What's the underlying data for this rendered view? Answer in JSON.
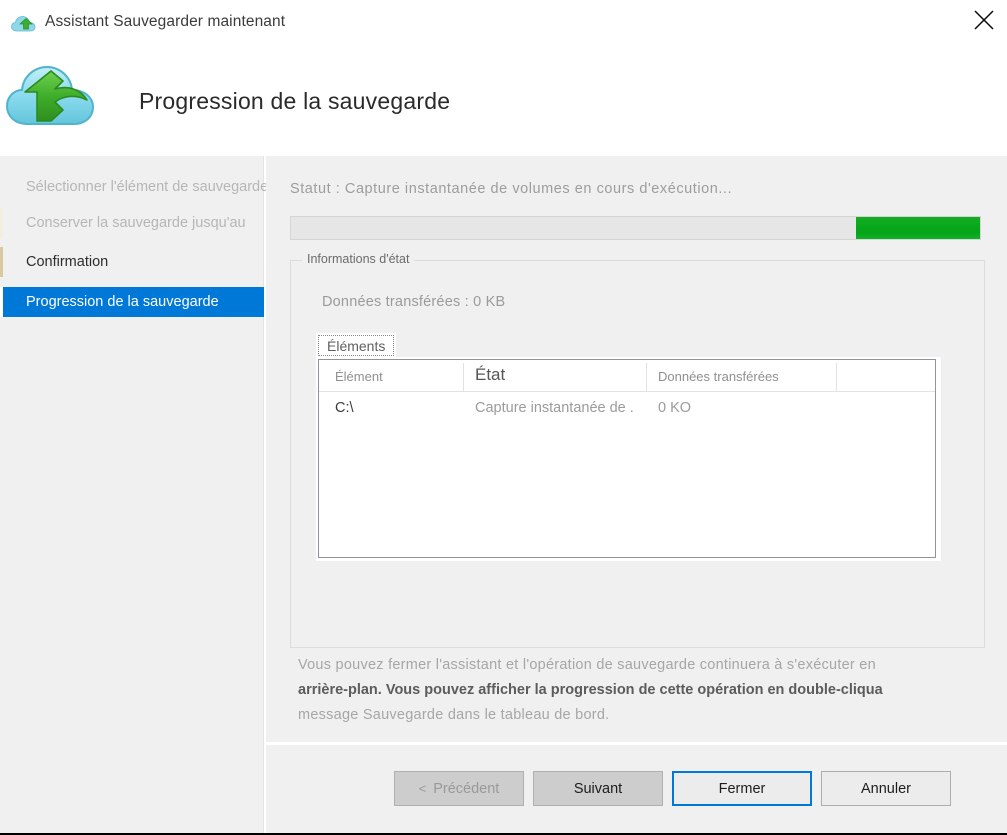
{
  "window": {
    "title": "Assistant Sauvegarder maintenant",
    "icon": "backup-cloud-icon",
    "close_label": "✕"
  },
  "header": {
    "title": "Progression de la sauvegarde",
    "icon": "backup-cloud-large-icon"
  },
  "sidebar": {
    "items": [
      {
        "label": "Sélectionner l'élément de sauvegarde",
        "state": "done"
      },
      {
        "label": "Conserver la sauvegarde jusqu'au",
        "state": "done"
      },
      {
        "label": "Confirmation",
        "state": "current-step"
      },
      {
        "label": "Progression de la sauvegarde",
        "state": "active"
      }
    ]
  },
  "main": {
    "status_label": "Statut :",
    "status_value": "Capture instantanée de volumes en cours d'exécution...",
    "status_full": "Statut :  Capture instantanée de volumes en cours d'exécution...",
    "progress": {
      "indeterminate": true,
      "chunk_left_pct": 82,
      "chunk_width_pct": 18,
      "color": "#07a81a"
    },
    "groupbox": {
      "legend": "Informations d'état",
      "transferred": "Données transférées : 0 KB",
      "tabs": [
        {
          "label": "Éléments",
          "selected": true
        }
      ],
      "table": {
        "columns": [
          "Élément",
          "État",
          "Données transférées",
          ""
        ],
        "rows": [
          {
            "element": "C:\\",
            "etat": "Capture instantanée de .",
            "transferred": "0 KO"
          }
        ]
      }
    },
    "note_lines": [
      "Vous pouvez fermer l'assistant et l'opération de sauvegarde continuera à s'exécuter en",
      "arrière-plan. Vous pouvez afficher la progression de cette opération en double-cliqua",
      "message Sauvegarde dans le tableau de bord."
    ]
  },
  "footer": {
    "buttons": [
      {
        "label": "Précédent",
        "chevron": "<",
        "style": "disabled",
        "name": "previous-button"
      },
      {
        "label": "Suivant",
        "chevron": "",
        "style": "default",
        "name": "next-button"
      },
      {
        "label": "Fermer",
        "chevron": "",
        "style": "focused",
        "name": "close-button"
      },
      {
        "label": "Annuler",
        "chevron": "",
        "style": "plain",
        "name": "cancel-button"
      }
    ]
  },
  "colors": {
    "accent": "#0078d7",
    "progress_green": "#07a81a",
    "panel": "#f0f0f0"
  }
}
